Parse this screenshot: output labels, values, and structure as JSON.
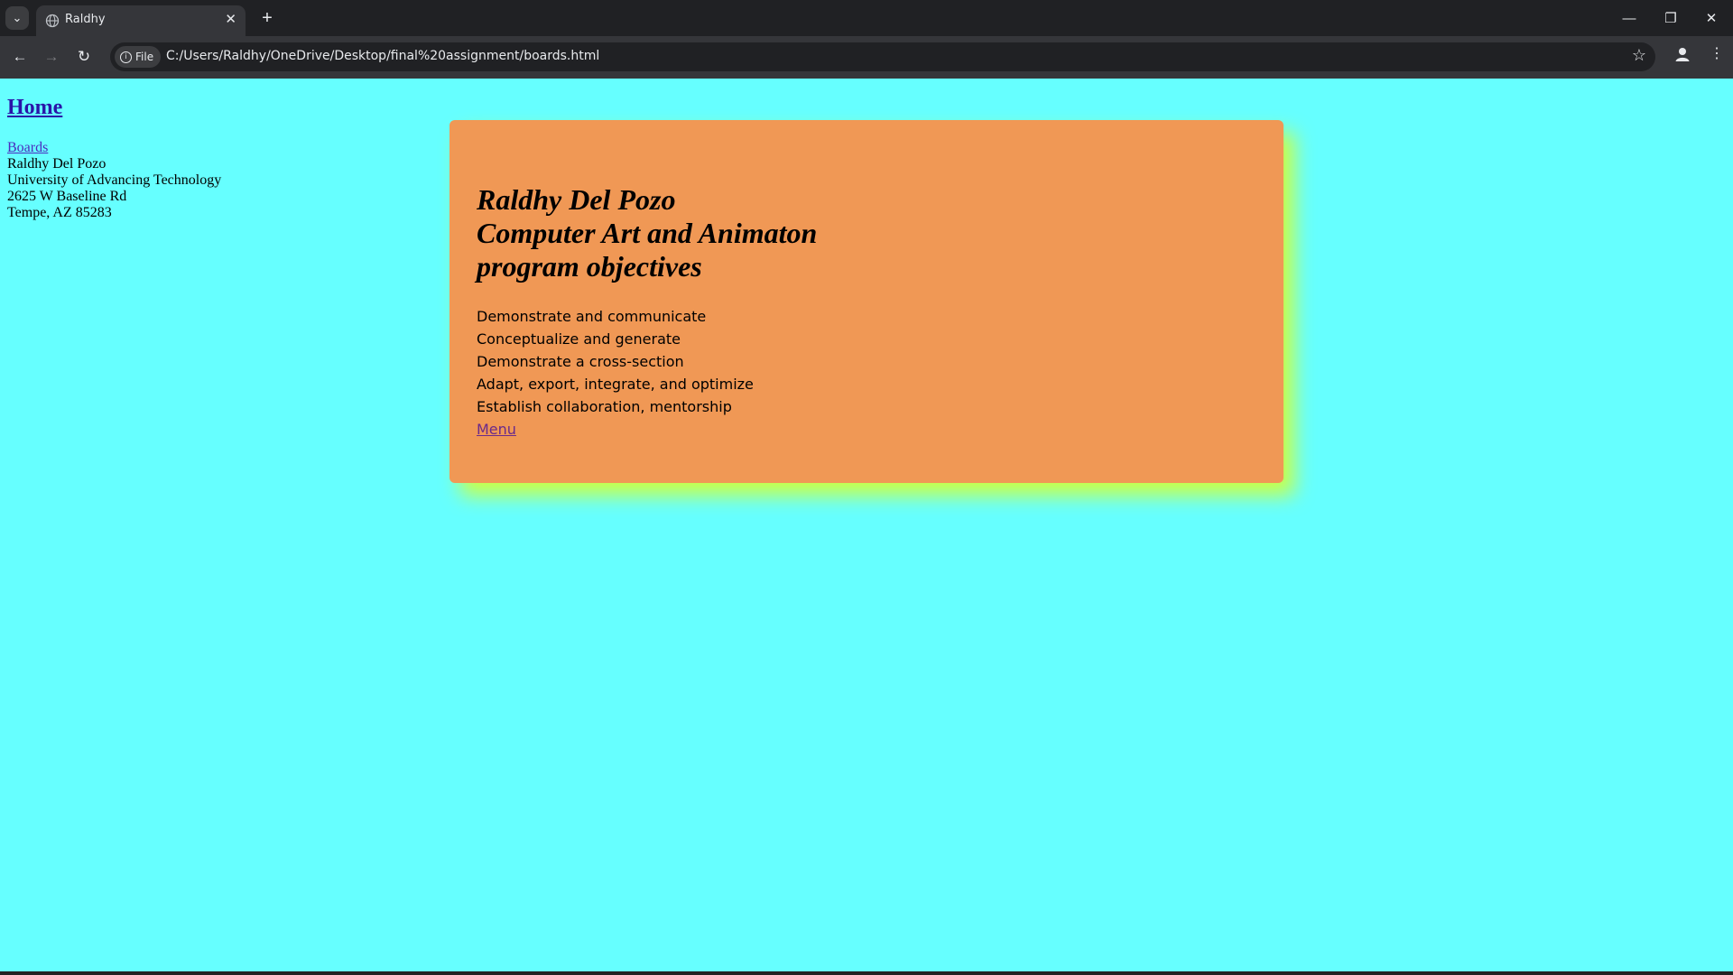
{
  "browser": {
    "tab_title": "Raldhy",
    "chip_label": "File",
    "url": "C:/Users/Raldhy/OneDrive/Desktop/final%20assignment/boards.html"
  },
  "page": {
    "home_link": "Home",
    "sidebar": {
      "boards_link": "Boards",
      "lines": [
        "Raldhy Del Pozo",
        "University of Advancing Technology",
        "2625 W Baseline Rd",
        "Tempe, AZ 85283"
      ]
    },
    "card": {
      "heading_lines": [
        "Raldhy Del Pozo",
        "Computer Art and Animaton",
        "program objectives"
      ],
      "objectives": [
        "Demonstrate and communicate",
        "Conceptualize and generate",
        "Demonstrate a cross-section",
        "Adapt, export, integrate, and optimize",
        "Establish collaboration, mentorship"
      ],
      "menu_link": "Menu"
    }
  },
  "colors": {
    "page_background": "#66ffff",
    "card_background": "#f09855",
    "card_shadow": "#ccff44"
  }
}
